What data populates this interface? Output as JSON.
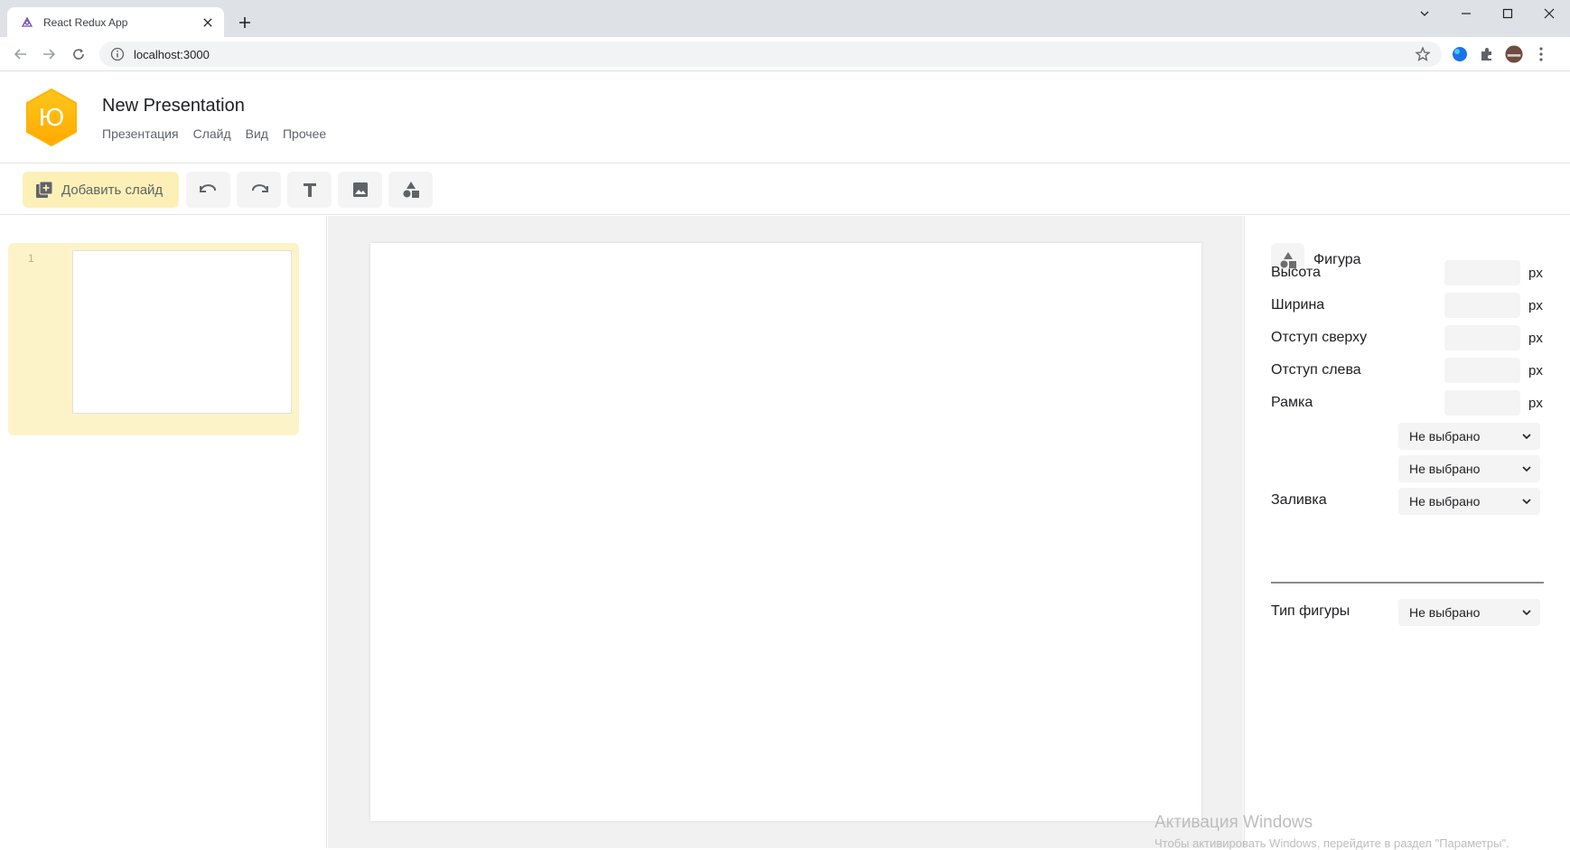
{
  "browser": {
    "tab_title": "React Redux App",
    "url": "localhost:3000",
    "tab_favicon": "react-redux-icon"
  },
  "app": {
    "logo_letter": "Ю",
    "title": "New Presentation",
    "menu": [
      "Презентация",
      "Слайд",
      "Вид",
      "Прочее"
    ],
    "accent_color": "#fdf0b7",
    "logo_color": "#ffb800"
  },
  "toolbar": {
    "add_slide_label": "Добавить слайд",
    "tools": [
      "undo-icon",
      "redo-icon",
      "text-icon",
      "image-icon",
      "shapes-icon"
    ]
  },
  "slides": {
    "items": [
      {
        "number": "1"
      }
    ]
  },
  "properties": {
    "header": "Фигура",
    "height_label": "Высота",
    "width_label": "Ширина",
    "top_label": "Отступ сверху",
    "left_label": "Отступ слева",
    "border_label": "Рамка",
    "unit": "px",
    "border_select_1": "Не выбрано",
    "border_select_2": "Не выбрано",
    "fill_label": "Заливка",
    "fill_select": "Не выбрано",
    "shape_type_label": "Тип фигуры",
    "shape_type_select": "Не выбрано"
  },
  "watermark": {
    "title": "Активация Windows",
    "subtitle": "Чтобы активировать Windows, перейдите в раздел \"Параметры\"."
  }
}
